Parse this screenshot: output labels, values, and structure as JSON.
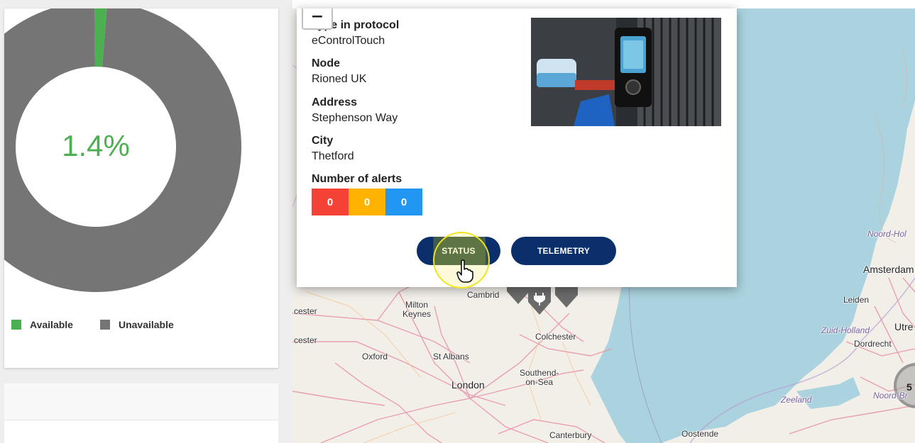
{
  "availability_chart": {
    "center_value": "1.4%",
    "available_fraction": 0.014,
    "colors": {
      "available": "#4caf50",
      "unavailable": "#757575",
      "center_text": "#4caf50"
    },
    "legend": [
      {
        "label": "Available",
        "color": "#4caf50"
      },
      {
        "label": "Unavailable",
        "color": "#757575"
      }
    ]
  },
  "popup": {
    "zoom_out_label": "−",
    "fields": [
      {
        "label": "Type in protocol",
        "value": "eControlTouch"
      },
      {
        "label": "Node",
        "value": "Rioned UK"
      },
      {
        "label": "Address",
        "value": "Stephenson Way"
      },
      {
        "label": "City",
        "value": "Thetford"
      }
    ],
    "alerts_label": "Number of alerts",
    "alerts": [
      {
        "count": "0",
        "color": "#f44336"
      },
      {
        "count": "0",
        "color": "#ffb300"
      },
      {
        "count": "0",
        "color": "#2196f3"
      }
    ],
    "buttons": {
      "status": "STATUS",
      "telemetry": "TELEMETRY"
    },
    "photo_icon": "device-photo"
  },
  "map": {
    "places": [
      {
        "name": "Cambrid",
        "kind": "town"
      },
      {
        "name": "Milton\nKeynes",
        "kind": "town"
      },
      {
        "name": "Colchester",
        "kind": "town"
      },
      {
        "name": "Oxford",
        "kind": "town"
      },
      {
        "name": "St Albans",
        "kind": "town"
      },
      {
        "name": "Southend-\non-Sea",
        "kind": "town"
      },
      {
        "name": "London",
        "kind": "city"
      },
      {
        "name": "Canterbury",
        "kind": "town"
      },
      {
        "name": "Oostende",
        "kind": "town"
      },
      {
        "name": "Amsterdam",
        "kind": "city"
      },
      {
        "name": "Leiden",
        "kind": "town"
      },
      {
        "name": "Zuid-Holland",
        "kind": "region"
      },
      {
        "name": "Utre",
        "kind": "town"
      },
      {
        "name": "Dordrecht",
        "kind": "town"
      },
      {
        "name": "Zeeland",
        "kind": "region"
      },
      {
        "name": "Noord-Hol",
        "kind": "region"
      },
      {
        "name": "Noord-Br",
        "kind": "region"
      },
      {
        "name": "cester",
        "kind": "town"
      },
      {
        "name": "cester",
        "kind": "town"
      }
    ],
    "cluster_count": "5",
    "colors": {
      "sea": "#aad3df",
      "land": "#f2efe9",
      "road": "#e892a2"
    }
  }
}
